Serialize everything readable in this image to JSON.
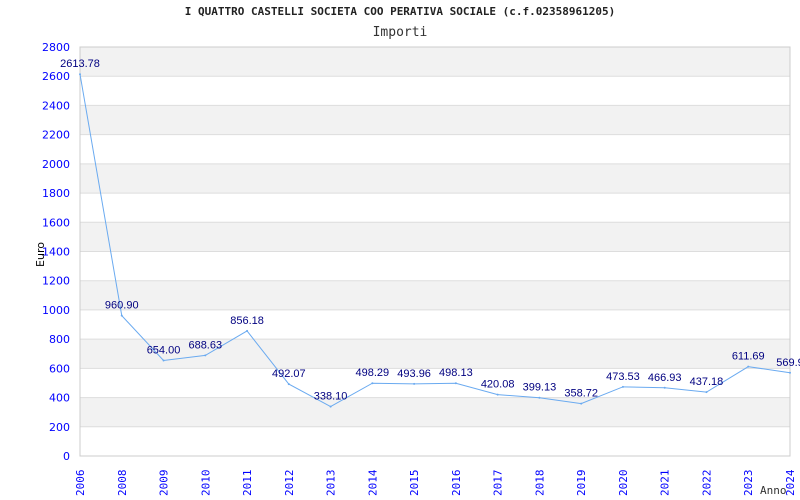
{
  "chart_data": {
    "type": "line",
    "title": "I QUATTRO CASTELLI SOCIETA COO PERATIVA SOCIALE (c.f.02358961205)",
    "subtitle": "Importi",
    "xlabel": "Anno",
    "ylabel": "Euro",
    "ylim": [
      0,
      2800
    ],
    "yticks": [
      0,
      200,
      400,
      600,
      800,
      1000,
      1200,
      1400,
      1600,
      1800,
      2000,
      2200,
      2400,
      2600,
      2800
    ],
    "grid": true,
    "categories": [
      "2006",
      "2008",
      "2009",
      "2010",
      "2011",
      "2012",
      "2013",
      "2014",
      "2015",
      "2016",
      "2017",
      "2018",
      "2019",
      "2020",
      "2021",
      "2022",
      "2023",
      "2024"
    ],
    "values": [
      2613.78,
      960.9,
      654.0,
      688.63,
      856.18,
      492.07,
      338.1,
      498.29,
      493.96,
      498.13,
      420.08,
      399.13,
      358.72,
      473.53,
      466.93,
      437.18,
      611.69,
      569.9
    ],
    "labels": [
      "2613.78",
      "960.90",
      "654.00",
      "688.63",
      "856.18",
      "492.07",
      "338.10",
      "498.29",
      "493.96",
      "498.13",
      "420.08",
      "399.13",
      "358.72",
      "473.53",
      "466.93",
      "437.18",
      "611.69",
      "569.9"
    ],
    "colors": {
      "line": "#6aaaf0",
      "tick": "#0000ff",
      "label": "#000080",
      "band": "#f2f2f2",
      "grid": "#dddddd"
    }
  }
}
